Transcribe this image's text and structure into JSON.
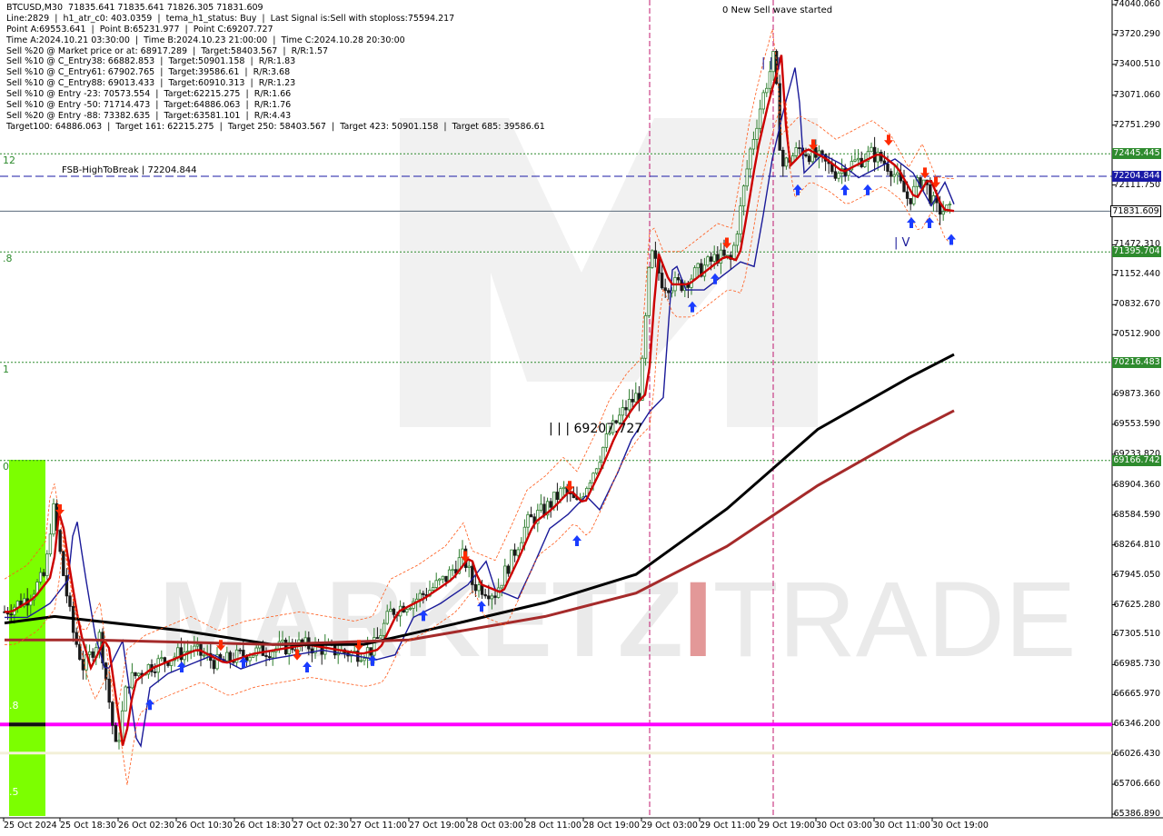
{
  "header": {
    "lines": [
      "BTCUSD,M30  71835.641 71835.641 71826.305 71831.609",
      "Line:2829  |  h1_atr_c0: 403.0359  |  tema_h1_status: Buy  |  Last Signal is:Sell with stoploss:75594.217",
      "Point A:69553.641  |  Point B:65231.977  |  Point C:69207.727",
      "Time A:2024.10.21 03:30:00  |  Time B:2024.10.23 21:00:00  |  Time C:2024.10.28 20:30:00",
      "Sell %20 @ Market price or at: 68917.289  |  Target:58403.567  |  R/R:1.57",
      "Sell %10 @ C_Entry38: 66882.853  |  Target:50901.158  |  R/R:1.83",
      "Sell %10 @ C_Entry61: 67902.765  |  Target:39586.61  |  R/R:3.68",
      "Sell %10 @ C_Entry88: 69013.433  |  Target:60910.313  |  R/R:1.23",
      "Sell %10 @ Entry -23: 70573.554  |  Target:62215.275  |  R/R:1.66",
      "Sell %10 @ Entry -50: 71714.473  |  Target:64886.063  |  R/R:1.76",
      "Sell %20 @ Entry -88: 73382.635  |  Target:63581.101  |  R/R:4.43",
      "Target100: 64886.063  |  Target 161: 62215.275  |  Target 250: 58403.567  |  Target 423: 50901.158  |  Target 685: 39586.61"
    ]
  },
  "annotations": {
    "wave_label": "0 New Sell wave started",
    "fsb_label": "FSB-HighToBreak  |  72204.844",
    "mid_label": "| | | 69207.727",
    "top_marks": "| | |",
    "bottom_marks": "| V",
    "left_levels": [
      "12",
      ".8",
      "1",
      "0",
      "1.8",
      "7.5"
    ]
  },
  "chart_data": {
    "type": "candlestick",
    "symbol": "BTCUSD",
    "timeframe": "M30",
    "ylim": [
      65386.89,
      74040.06
    ],
    "price_ticks": [
      "74040.060",
      "73720.290",
      "73400.510",
      "73071.060",
      "72751.290",
      "72431.510",
      "72111.750",
      "71791.970",
      "71472.310",
      "71152.440",
      "70832.670",
      "70512.900",
      "70193.120",
      "69873.360",
      "69553.590",
      "69233.820",
      "68904.360",
      "68584.590",
      "68264.810",
      "67945.050",
      "67625.280",
      "67305.510",
      "66985.730",
      "66665.970",
      "66346.200",
      "66026.430",
      "65706.660",
      "65386.890"
    ],
    "time_labels": [
      "25 Oct 2024",
      "25 Oct 18:30",
      "26 Oct 02:30",
      "26 Oct 10:30",
      "26 Oct 18:30",
      "27 Oct 02:30",
      "27 Oct 11:00",
      "27 Oct 19:00",
      "28 Oct 03:00",
      "28 Oct 11:00",
      "28 Oct 19:00",
      "29 Oct 03:00",
      "29 Oct 11:00",
      "29 Oct 19:00",
      "30 Oct 03:00",
      "30 Oct 11:00",
      "30 Oct 19:00"
    ],
    "levels": [
      {
        "value": 72445.445,
        "label": "72445.445",
        "style": "dotted",
        "color": "#2e8b2e"
      },
      {
        "value": 72204.844,
        "label": "72204.844",
        "style": "dashed",
        "color": "#1a1aa6"
      },
      {
        "value": 71831.609,
        "label": "71831.609",
        "style": "solid",
        "color": "#5a6a7a"
      },
      {
        "value": 71395.704,
        "label": "71395.704",
        "style": "dotted",
        "color": "#2e8b2e"
      },
      {
        "value": 70216.483,
        "label": "70216.483",
        "style": "dotted",
        "color": "#2e8b2e"
      },
      {
        "value": 69166.742,
        "label": "69166.742",
        "style": "dotted",
        "color": "#2e8b2e"
      },
      {
        "value": 66346.2,
        "label": "",
        "style": "solid",
        "color": "#ff00ff"
      },
      {
        "value": 66040,
        "label": "",
        "style": "solid",
        "color": "#f3f0d8"
      }
    ],
    "current_price": 71831.609,
    "watermark": [
      "MARKETZ",
      "I",
      "TRADE"
    ],
    "colors": {
      "bull": "#2e7d2e",
      "bear": "#1a1a1a",
      "ma_fast": "#cc0000",
      "ma_mid": "#1a1a99",
      "ma_slow": "#000000",
      "ma_long": "#a52a2a",
      "signal_buy": "#1a3cff",
      "signal_sell": "#ff2a00",
      "zone": "#7cff00"
    }
  }
}
